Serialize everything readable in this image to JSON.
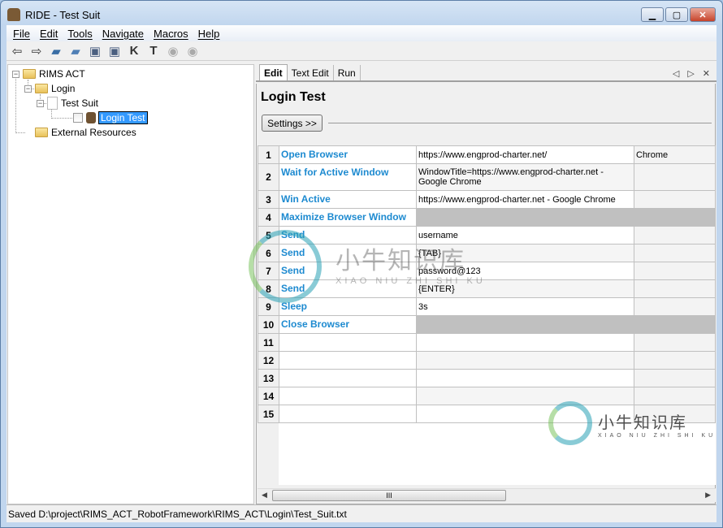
{
  "window": {
    "title": "RIDE - Test Suit",
    "controls": [
      "minimize",
      "maximize",
      "close"
    ]
  },
  "menu": [
    "File",
    "Edit",
    "Tools",
    "Navigate",
    "Macros",
    "Help"
  ],
  "toolbar": [
    "back-icon",
    "forward-icon",
    "open-test-suite-icon",
    "open-directory-icon",
    "save-icon",
    "save-all-icon",
    "search-keywords-icon",
    "search-tests-icon",
    "run-icon",
    "stop-icon"
  ],
  "tree": {
    "root": "RIMS ACT",
    "suite": "Login",
    "file": "Test Suit",
    "test": "Login Test",
    "resources": "External Resources"
  },
  "tabs": [
    "Edit",
    "Text Edit",
    "Run"
  ],
  "editor": {
    "title": "Login Test",
    "settings_label": "Settings >>",
    "rows": [
      {
        "n": "1",
        "kw": "Open Browser",
        "a1": "https://www.engprod-charter.net/",
        "a2": "Chrome"
      },
      {
        "n": "2",
        "kw": "Wait for Active Window",
        "a1": "WindowTitle=https://www.engprod-charter.net - Google Chrome",
        "a2": ""
      },
      {
        "n": "3",
        "kw": "Win Active",
        "a1": "https://www.engprod-charter.net - Google Chrome",
        "a2": ""
      },
      {
        "n": "4",
        "kw": "Maximize Browser Window",
        "a1": "",
        "a2": "",
        "empty": true
      },
      {
        "n": "5",
        "kw": "Send",
        "a1": "username",
        "a2": ""
      },
      {
        "n": "6",
        "kw": "Send",
        "a1": "{TAB}",
        "a2": ""
      },
      {
        "n": "7",
        "kw": "Send",
        "a1": "password@123",
        "a2": ""
      },
      {
        "n": "8",
        "kw": "Send",
        "a1": "{ENTER}",
        "a2": ""
      },
      {
        "n": "9",
        "kw": "Sleep",
        "a1": "3s",
        "a2": ""
      },
      {
        "n": "10",
        "kw": "Close Browser",
        "a1": "",
        "a2": "",
        "empty": true
      },
      {
        "n": "11",
        "kw": "",
        "a1": "",
        "a2": ""
      },
      {
        "n": "12",
        "kw": "",
        "a1": "",
        "a2": ""
      },
      {
        "n": "13",
        "kw": "",
        "a1": "",
        "a2": ""
      },
      {
        "n": "14",
        "kw": "",
        "a1": "",
        "a2": ""
      },
      {
        "n": "15",
        "kw": "",
        "a1": "",
        "a2": ""
      }
    ]
  },
  "status": "Saved D:\\project\\RIMS_ACT_RobotFramework\\RIMS_ACT\\Login\\Test_Suit.txt",
  "watermark": {
    "text": "小牛知识库",
    "sub": "XIAO NIU ZHI SHI KU"
  }
}
